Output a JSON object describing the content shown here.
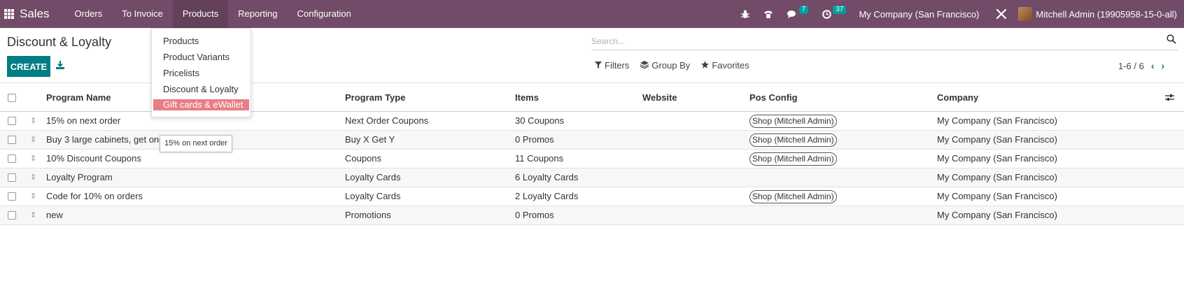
{
  "navbar": {
    "brand": "Sales",
    "menu": [
      "Orders",
      "To Invoice",
      "Products",
      "Reporting",
      "Configuration"
    ],
    "active_menu": "Products",
    "messages_count": "7",
    "activities_count": "37",
    "company": "My Company (San Francisco)",
    "user": "Mitchell Admin (19905958-15-0-all)"
  },
  "control_panel": {
    "title": "Discount & Loyalty",
    "create_label": "CREATE",
    "search_placeholder": "Search...",
    "filters_label": "Filters",
    "group_by_label": "Group By",
    "favorites_label": "Favorites",
    "pager": "1-6 / 6"
  },
  "columns": [
    "Program Name",
    "Program Type",
    "Items",
    "Website",
    "Pos Config",
    "Company"
  ],
  "rows": [
    {
      "name": "15% on next order",
      "type": "Next Order Coupons",
      "items": "30 Coupons",
      "website": "",
      "pos": "Shop (Mitchell Admin)",
      "company": "My Company (San Francisco)"
    },
    {
      "name": "Buy 3 large cabinets, get one",
      "type": "Buy X Get Y",
      "items": "0 Promos",
      "website": "",
      "pos": "Shop (Mitchell Admin)",
      "company": "My Company (San Francisco)"
    },
    {
      "name": "10% Discount Coupons",
      "type": "Coupons",
      "items": "11 Coupons",
      "website": "",
      "pos": "Shop (Mitchell Admin)",
      "company": "My Company (San Francisco)"
    },
    {
      "name": "Loyalty Program",
      "type": "Loyalty Cards",
      "items": "6 Loyalty Cards",
      "website": "",
      "pos": "",
      "company": "My Company (San Francisco)"
    },
    {
      "name": "Code for 10% on orders",
      "type": "Loyalty Cards",
      "items": "2 Loyalty Cards",
      "website": "",
      "pos": "Shop (Mitchell Admin)",
      "company": "My Company (San Francisco)"
    },
    {
      "name": "new",
      "type": "Promotions",
      "items": "0 Promos",
      "website": "",
      "pos": "",
      "company": "My Company (San Francisco)"
    }
  ],
  "dropdown": {
    "items": [
      "Products",
      "Product Variants",
      "Pricelists",
      "Discount & Loyalty",
      "Gift cards & eWallet"
    ],
    "highlighted": "Gift cards & eWallet"
  },
  "tooltip": "15% on next order",
  "colors": {
    "navbar": "#714B67",
    "primary": "#017E84",
    "highlight": "#e87d86"
  }
}
